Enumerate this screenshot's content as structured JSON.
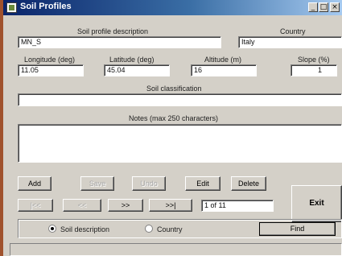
{
  "window": {
    "title": "Soil Profiles",
    "minimize": "_",
    "restore": "□",
    "close": "×"
  },
  "form": {
    "soil_profile_description_label": "Soil profile description",
    "soil_profile_description_value": "MN_S",
    "country_label": "Country",
    "country_value": "Italy",
    "longitude_label": "Longitude (deg)",
    "longitude_value": "11.05",
    "latitude_label": "Latitude (deg)",
    "latitude_value": "45.04",
    "altitude_label": "Altitude (m)",
    "altitude_value": "16",
    "slope_label": "Slope (%)",
    "slope_value": "1",
    "soil_classification_label": "Soil classification",
    "soil_classification_value": "",
    "notes_label": "Notes (max 250 characters)",
    "notes_value": ""
  },
  "buttons": {
    "add": "Add",
    "save": "Save",
    "undo": "Undo",
    "edit": "Edit",
    "delete": "Delete",
    "first": "|<<",
    "previous": "<<",
    "next": ">>",
    "last": ">>|",
    "exit": "Exit",
    "find": "Find"
  },
  "navigation": {
    "record_position": "1 of 11"
  },
  "search": {
    "option_soil_description": "Soil description",
    "option_country": "Country",
    "selected": "Soil description"
  }
}
